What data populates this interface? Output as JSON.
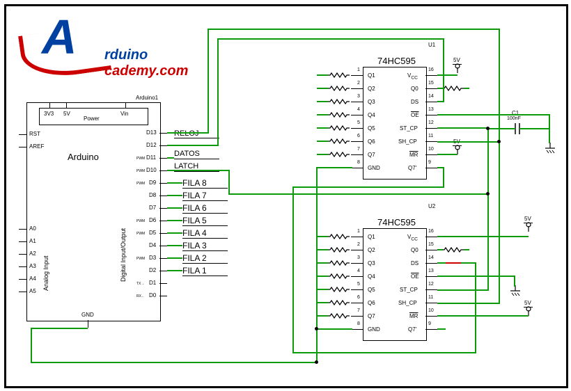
{
  "logo": {
    "letter": "A",
    "brand1": "rduino",
    "brand2": "cademy.com"
  },
  "arduino": {
    "ref": "Arduino1",
    "label": "Arduino",
    "power_sec": "Power",
    "pwr": {
      "v33": "3V3",
      "v5": "5V",
      "vin": "Vin"
    },
    "left": [
      "RST",
      "AREF",
      "A0",
      "A1",
      "A2",
      "A3",
      "A4",
      "A5"
    ],
    "gnd": "GND",
    "right": [
      "D13",
      "D12",
      "D11",
      "D10",
      "D9",
      "D8",
      "D7",
      "D6",
      "D5",
      "D4",
      "D3",
      "D2",
      "D1",
      "D0"
    ],
    "dio_label": "Digital Input/Output",
    "ain_label": "Analog Input",
    "pwm": "PWM",
    "signals": {
      "reloj": "RELOJ",
      "datos": "DATOS",
      "latch": "LATCH",
      "f8": "FILA 8",
      "f7": "FILA 7",
      "f6": "FILA 6",
      "f5": "FILA 5",
      "f4": "FILA 4",
      "f3": "FILA 3",
      "f2": "FILA 2",
      "f1": "FILA 1"
    },
    "txrx": {
      "tx": "TX→",
      "rx": "RX←"
    }
  },
  "u1": {
    "ref": "U1",
    "title": "74HC595",
    "left": [
      "Q1",
      "Q2",
      "Q3",
      "Q4",
      "Q5",
      "Q6",
      "Q7",
      "GND"
    ],
    "leftnum": [
      "1",
      "2",
      "3",
      "4",
      "5",
      "6",
      "7",
      "8"
    ],
    "right": [
      "VCC",
      "Q0",
      "DS",
      "OE",
      "ST_CP",
      "SH_CP",
      "MR",
      "Q7'"
    ],
    "rightnum": [
      "16",
      "15",
      "14",
      "13",
      "12",
      "11",
      "10",
      "9"
    ]
  },
  "u2": {
    "ref": "U2",
    "title": "74HC595",
    "left": [
      "Q1",
      "Q2",
      "Q3",
      "Q4",
      "Q5",
      "Q6",
      "Q7",
      "GND"
    ],
    "leftnum": [
      "1",
      "2",
      "3",
      "4",
      "5",
      "6",
      "7",
      "8"
    ],
    "right": [
      "VCC",
      "Q0",
      "DS",
      "OE",
      "ST_CP",
      "SH_CP",
      "MR",
      "Q7'"
    ],
    "rightnum": [
      "16",
      "15",
      "14",
      "13",
      "12",
      "11",
      "10",
      "9"
    ]
  },
  "misc": {
    "v5": "5V",
    "c1": "C1",
    "c1val": "100nF"
  }
}
